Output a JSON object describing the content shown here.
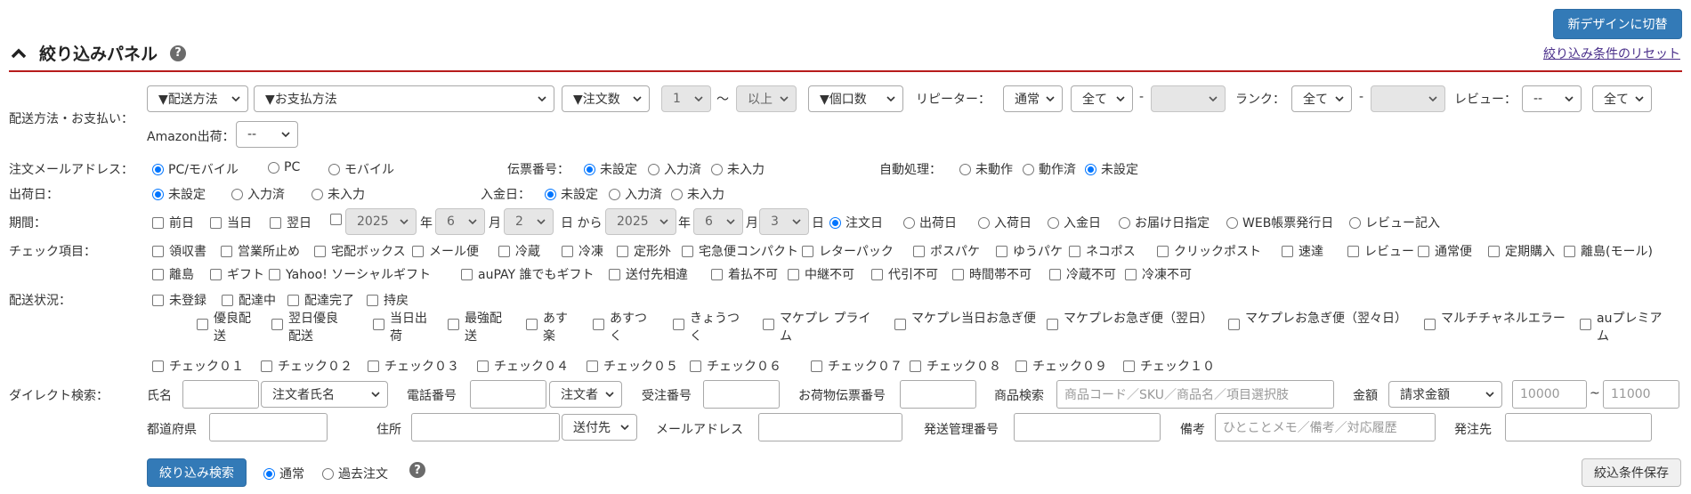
{
  "header": {
    "new_design_button": "新デザインに切替",
    "title": "絞り込みパネル",
    "help": "?",
    "reset_link": "絞り込み条件のリセット"
  },
  "delivery_payment": {
    "label": "配送方法・お支払い：",
    "delivery_method": "▼配送方法",
    "payment_method": "▼お支払方法",
    "order_count": "▼注文数",
    "count_value": "1",
    "tilde": "〜",
    "count_cond": "以上",
    "item_count": "▼個口数",
    "repeater_label": "リピーター：",
    "repeater_type": "通常",
    "repeater_from": "全て",
    "dash": "-",
    "repeater_to": "",
    "rank_label": "ランク：",
    "rank_from": "全て",
    "rank_to": "",
    "review_label": "レビュー：",
    "review_value": "--",
    "review_all": "全て",
    "amazon_label": "Amazon出荷：",
    "amazon_value": "--"
  },
  "mail": {
    "label": "注文メールアドレス：",
    "options": [
      "PC/モバイル",
      "PC",
      "モバイル"
    ],
    "slip_label": "伝票番号：",
    "slip_options": [
      "未設定",
      "入力済",
      "未入力"
    ],
    "auto_label": "自動処理：",
    "auto_options": [
      "未動作",
      "動作済",
      "未設定"
    ]
  },
  "ship_date": {
    "label": "出荷日：",
    "options": [
      "未設定",
      "入力済",
      "未入力"
    ],
    "payment_label": "入金日：",
    "payment_options": [
      "未設定",
      "入力済",
      "未入力"
    ]
  },
  "period": {
    "label": "期間：",
    "prev_day": "前日",
    "today": "当日",
    "next_day": "翌日",
    "year_from": "2025",
    "year_unit": "年",
    "month_from": "6",
    "month_unit": "月",
    "day_from": "2",
    "day_unit_from": "日 から",
    "year_to": "2025",
    "month_to": "6",
    "day_to": "3",
    "day_unit": "日",
    "options": [
      "注文日",
      "出荷日",
      "入荷日",
      "入金日",
      "お届け日指定",
      "WEB帳票発行日",
      "レビュー記入"
    ]
  },
  "check_items": {
    "label": "チェック項目：",
    "row1": [
      "領収書",
      "営業所止め",
      "宅配ボックス",
      "メール便",
      "冷蔵",
      "冷凍",
      "定形外",
      "宅急便コンパクト",
      "レターパック",
      "ポスパケ",
      "ゆうパケ",
      "ネコポス",
      "クリックポスト",
      "速達",
      "レビュー",
      "通常便",
      "定期購入",
      "離島(モール)"
    ],
    "row2": [
      "離島",
      "ギフト",
      "Yahoo! ソーシャルギフト",
      "auPAY 誰でもギフト",
      "送付先相違",
      "着払不可",
      "中継不可",
      "代引不可",
      "時間帯不可",
      "冷蔵不可",
      "冷凍不可"
    ]
  },
  "delivery_status": {
    "label": "配送状況：",
    "options": [
      "未登録",
      "配達中",
      "配達完了",
      "持戻"
    ],
    "services": [
      "優良配送",
      "翌日優良配送",
      "当日出荷",
      "最強配送",
      "あす楽",
      "あすつく",
      "きょうつく",
      "マケプレ プライム",
      "マケプレ当日お急ぎ便",
      "マケプレお急ぎ便（翌日）",
      "マケプレお急ぎ便（翌々日）",
      "マルチチャネルエラー",
      "auプレミアム"
    ],
    "checks": [
      "チェック０１",
      "チェック０２",
      "チェック０３",
      "チェック０４",
      "チェック０５",
      "チェック０６",
      "チェック０７",
      "チェック０８",
      "チェック０９",
      "チェック１０"
    ]
  },
  "direct_search": {
    "label": "ダイレクト検索：",
    "name_label": "氏名",
    "name_type": "注文者氏名",
    "phone_label": "電話番号",
    "phone_type": "注文者",
    "order_no_label": "受注番号",
    "tracking_label": "お荷物伝票番号",
    "product_label": "商品検索",
    "product_placeholder": "商品コード／SKU／商品名／項目選択肢",
    "amount_label": "金額",
    "amount_type": "請求金額",
    "amount_from": "10000",
    "amount_tilde": "~",
    "amount_to": "11000",
    "pref_label": "都道府県",
    "address_label": "住所",
    "address_type": "送付先",
    "email_label": "メールアドレス",
    "ship_mgmt_label": "発送管理番号",
    "memo_label": "備考",
    "memo_placeholder": "ひとことメモ／備考／対応履歴",
    "supplier_label": "発注先"
  },
  "footer": {
    "search_button": "絞り込み検索",
    "normal": "通常",
    "past": "過去注文",
    "help": "?",
    "save_button": "絞込条件保存"
  }
}
